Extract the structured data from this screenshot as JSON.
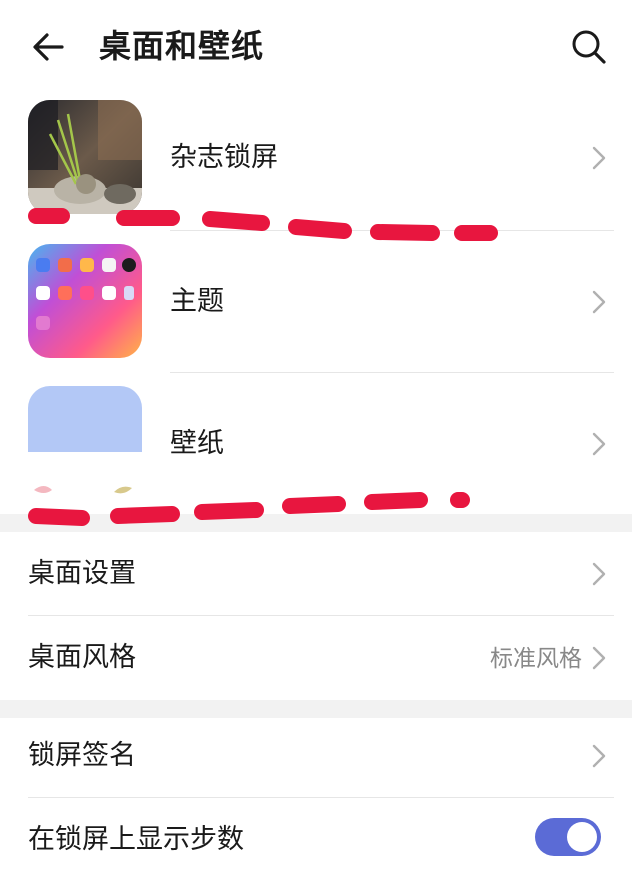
{
  "header": {
    "title": "桌面和壁纸",
    "back_icon": "back-arrow-icon",
    "search_icon": "search-icon"
  },
  "cards": [
    {
      "label": "杂志锁屏",
      "icon": "magazine-lockscreen-thumbnail"
    },
    {
      "label": "主题",
      "icon": "theme-thumbnail"
    },
    {
      "label": "壁纸",
      "icon": "wallpaper-thumbnail"
    }
  ],
  "settings": {
    "desktop_settings": {
      "label": "桌面设置"
    },
    "desktop_style": {
      "label": "桌面风格",
      "value": "标准风格"
    },
    "lockscreen_signature": {
      "label": "锁屏签名"
    },
    "show_steps": {
      "label": "在锁屏上显示步数",
      "enabled": true
    }
  },
  "colors": {
    "accent": "#5b6bd6",
    "annotation": "#e8163f",
    "section_gap": "#f2f2f2",
    "secondary_text": "#888888"
  }
}
